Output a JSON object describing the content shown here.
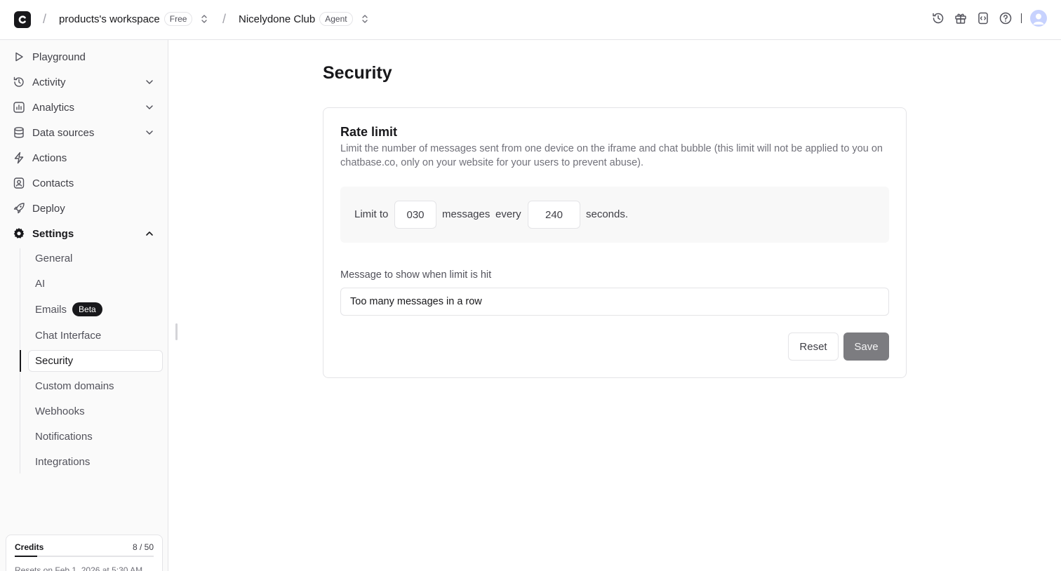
{
  "header": {
    "workspace_name": "products's workspace",
    "workspace_plan": "Free",
    "agent_name": "Nicelydone Club",
    "agent_badge": "Agent",
    "separator": "/",
    "divider": "|"
  },
  "sidebar": {
    "items": [
      {
        "label": "Playground",
        "icon": "play-icon"
      },
      {
        "label": "Activity",
        "icon": "history-icon",
        "expandable": true
      },
      {
        "label": "Analytics",
        "icon": "chart-icon",
        "expandable": true
      },
      {
        "label": "Data sources",
        "icon": "database-icon",
        "expandable": true
      },
      {
        "label": "Actions",
        "icon": "bolt-icon"
      },
      {
        "label": "Contacts",
        "icon": "contact-icon"
      },
      {
        "label": "Deploy",
        "icon": "rocket-icon"
      },
      {
        "label": "Settings",
        "icon": "gear-icon",
        "expanded": true
      }
    ],
    "settings_items": [
      {
        "label": "General"
      },
      {
        "label": "AI"
      },
      {
        "label": "Emails",
        "badge": "Beta"
      },
      {
        "label": "Chat Interface"
      },
      {
        "label": "Security",
        "active": true
      },
      {
        "label": "Custom domains"
      },
      {
        "label": "Webhooks"
      },
      {
        "label": "Notifications"
      },
      {
        "label": "Integrations"
      }
    ],
    "credits": {
      "label": "Credits",
      "count": "8 / 50",
      "used_fraction": 0.16,
      "reset_text": "Resets on Feb 1, 2026 at 5:30 AM"
    }
  },
  "main": {
    "page_title": "Security",
    "rate_limit": {
      "title": "Rate limit",
      "description": "Limit the number of messages sent from one device on the iframe and chat bubble (this limit will not be applied to you on chatbase.co, only on your website for your users to prevent abuse).",
      "limit_to_label": "Limit to",
      "messages_value": "030",
      "messages_label": "messages",
      "every_label": "every",
      "seconds_value": "240",
      "seconds_label": "seconds.",
      "message_label": "Message to show when limit is hit",
      "message_value": "Too many messages in a row",
      "reset_label": "Reset",
      "save_label": "Save"
    }
  },
  "colors": {
    "accent": "#18181b",
    "border": "#e4e4e7",
    "muted_text": "#71717a",
    "save_disabled": "#7c7c80"
  }
}
